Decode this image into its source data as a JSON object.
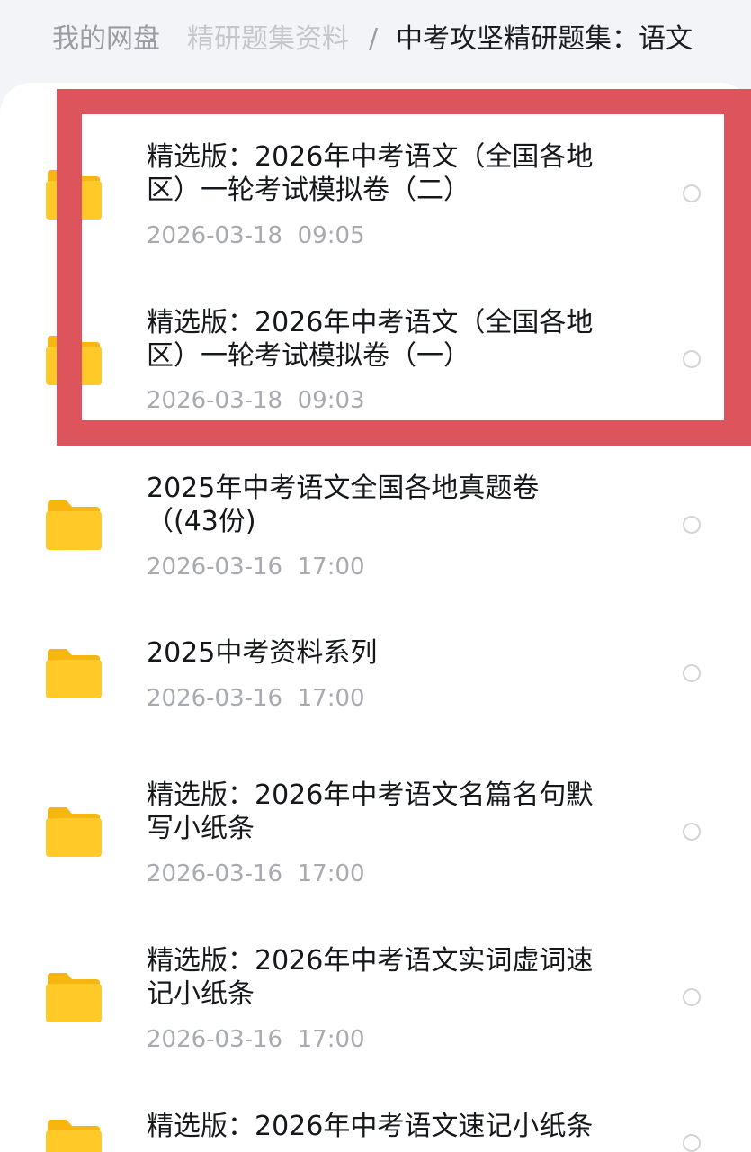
{
  "breadcrumb": {
    "home": "我的网盘",
    "parent": "精研题集资料",
    "separator": "/",
    "current": "中考攻坚精研题集：语文"
  },
  "folder_icon": "folder-icon",
  "colors": {
    "folder": "#ffc927",
    "highlight": "#dd545c",
    "date_text": "#a8aab0"
  },
  "files": [
    {
      "name_lines": [
        "精选版：2026年中考语文（全国各地",
        "区）一轮考试模拟卷（二）"
      ],
      "date": "2026-03-18  09:05"
    },
    {
      "name_lines": [
        "精选版：2026年中考语文（全国各地",
        "区）一轮考试模拟卷（一）"
      ],
      "date": "2026-03-18  09:03"
    },
    {
      "name_lines": [
        "2025年中考语文全国各地真题卷",
        "（(43份)"
      ],
      "date": "2026-03-16  17:00"
    },
    {
      "name_lines": [
        "2025中考资料系列"
      ],
      "date": "2026-03-16  17:00"
    },
    {
      "name_lines": [
        "精选版：2026年中考语文名篇名句默",
        "写小纸条"
      ],
      "date": "2026-03-16  17:00"
    },
    {
      "name_lines": [
        "精选版：2026年中考语文实词虚词速",
        "记小纸条"
      ],
      "date": "2026-03-16  17:00"
    },
    {
      "name_lines": [
        "精选版：2026年中考语文速记小纸条"
      ],
      "date": ""
    }
  ]
}
